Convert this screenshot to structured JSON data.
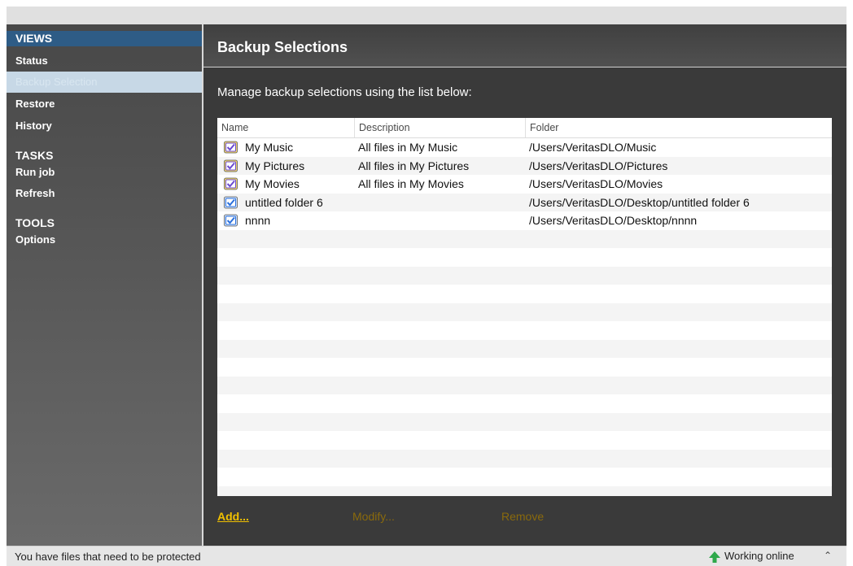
{
  "sidebar": {
    "views_header": "VIEWS",
    "views": [
      "Status",
      "Backup Selection",
      "Restore",
      "History"
    ],
    "tasks_header": "TASKS",
    "tasks": [
      "Run job",
      "Refresh"
    ],
    "tools_header": "TOOLS",
    "tools": [
      "Options"
    ]
  },
  "main": {
    "title": "Backup Selections",
    "instructions": "Manage backup selections using the list below:",
    "columns": [
      "Name",
      "Description",
      "Folder"
    ],
    "rows": [
      {
        "name": "My Music",
        "description": "All files in My Music",
        "folder": "/Users/VeritasDLO/Music",
        "icon": "music-folder-icon"
      },
      {
        "name": "My Pictures",
        "description": "All files in My Pictures",
        "folder": "/Users/VeritasDLO/Pictures",
        "icon": "pictures-folder-icon"
      },
      {
        "name": "My Movies",
        "description": "All files in My Movies",
        "folder": "/Users/VeritasDLO/Movies",
        "icon": "movies-folder-icon"
      },
      {
        "name": "untitled folder 6",
        "description": "",
        "folder": "/Users/VeritasDLO/Desktop/untitled folder 6",
        "icon": "custom-folder-icon"
      },
      {
        "name": "nnnn",
        "description": "",
        "folder": "/Users/VeritasDLO/Desktop/nnnn",
        "icon": "custom-folder-icon"
      }
    ],
    "actions": {
      "add": "Add...",
      "modify": "Modify...",
      "remove": "Remove"
    }
  },
  "status": {
    "message": "You have files that need to be protected",
    "connection": "Working online",
    "connection_icon": "up-arrow-icon"
  },
  "colors": {
    "views_header_bg": "#2e5c86",
    "add_link": "#f0c000",
    "online_arrow": "#2ea84a"
  }
}
